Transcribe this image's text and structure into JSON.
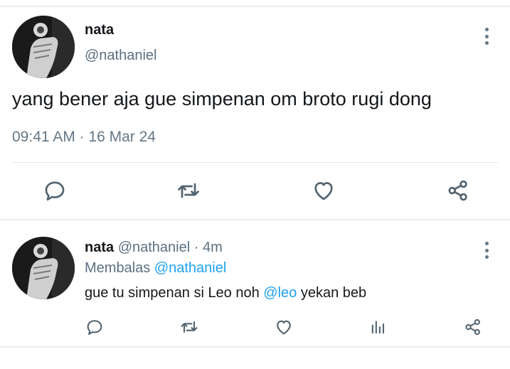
{
  "main_tweet": {
    "display_name": "nata",
    "handle": "@nathaniel",
    "text": "yang bener aja gue simpenan om broto rugi dong",
    "timestamp": "09:41 AM · 16 Mar 24",
    "actions": [
      "reply-icon",
      "retweet-icon",
      "like-icon",
      "share-icon"
    ]
  },
  "reply": {
    "display_name": "nata",
    "handle": "@nathaniel",
    "time_sep": " · ",
    "age": "4m",
    "replying_prefix": "Membalas ",
    "replying_to": "@nathaniel",
    "text_before": "gue tu simpenan si Leo noh ",
    "mention": "@leo",
    "text_after": " yekan beb",
    "actions": [
      "reply-icon",
      "retweet-icon",
      "like-icon",
      "analytics-icon",
      "share-icon"
    ]
  },
  "colors": {
    "link": "#1da1f2",
    "secondary_text": "#657786",
    "icon": "#536471"
  }
}
